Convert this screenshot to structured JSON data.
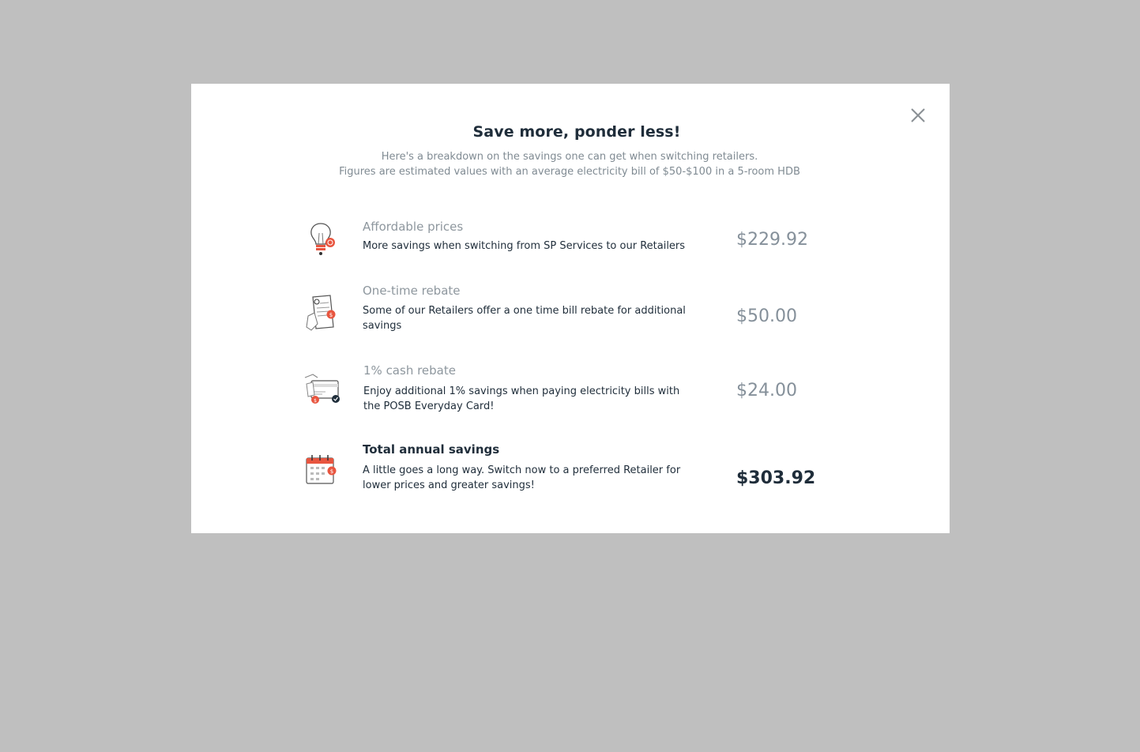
{
  "modal": {
    "title": "Save more, ponder less!",
    "subtitle_line1": "Here's a breakdown on the savings one can get when switching retailers.",
    "subtitle_line2": "Figures are estimated values with an average electricity bill of $50-$100 in a 5-room HDB",
    "close_icon": "close-icon"
  },
  "rows": [
    {
      "icon": "lightbulb-icon",
      "title": "Affordable prices",
      "description": "More savings when switching from SP Services to our Retailers",
      "amount": "$229.92"
    },
    {
      "icon": "bill-rebate-icon",
      "title": "One-time rebate",
      "description": "Some of our Retailers offer a one time bill rebate for additional savings",
      "amount": "$50.00"
    },
    {
      "icon": "card-cash-icon",
      "title": "1% cash rebate",
      "description": "Enjoy additional 1% savings when paying electricity bills with the POSB Everyday Card!",
      "amount": "$24.00"
    }
  ],
  "total": {
    "icon": "calendar-icon",
    "title": "Total annual savings",
    "description": "A little goes a long way. Switch now to a preferred Retailer for lower prices and greater savings!",
    "amount": "$303.92"
  },
  "colors": {
    "overlay": "#bfbfbf",
    "accent_red": "#e8553f",
    "text_dark": "#1f2d3a",
    "text_muted": "#8e979e"
  }
}
